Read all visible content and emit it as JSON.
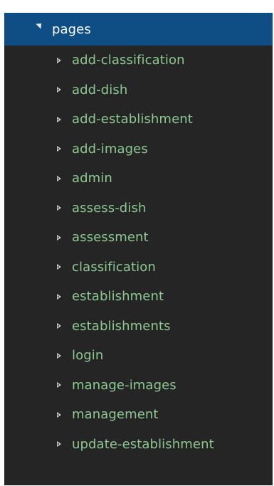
{
  "explorer": {
    "root": {
      "label": "pages",
      "expanded": true
    },
    "items": [
      {
        "label": "add-classification"
      },
      {
        "label": "add-dish"
      },
      {
        "label": "add-establishment"
      },
      {
        "label": "add-images"
      },
      {
        "label": "admin"
      },
      {
        "label": "assess-dish"
      },
      {
        "label": "assessment"
      },
      {
        "label": "classification"
      },
      {
        "label": "establishment"
      },
      {
        "label": "establishments"
      },
      {
        "label": "login"
      },
      {
        "label": "manage-images"
      },
      {
        "label": "management"
      },
      {
        "label": "update-establishment"
      }
    ]
  },
  "colors": {
    "panel_background": "#252526",
    "selected_row": "#0e4e84",
    "folder_text": "#8dc891",
    "selected_text": "#ffffff"
  },
  "icons": {
    "expanded": "triangle-down-right-icon",
    "collapsed": "triangle-right-icon"
  }
}
